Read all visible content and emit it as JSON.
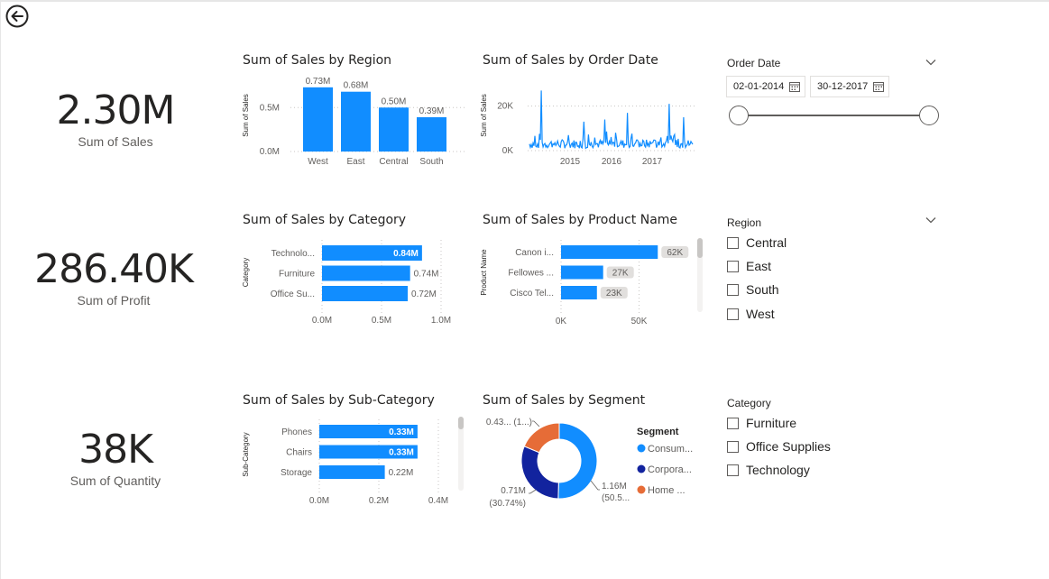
{
  "kpis": [
    {
      "value": "2.30M",
      "label": "Sum of Sales"
    },
    {
      "value": "286.40K",
      "label": "Sum of Profit"
    },
    {
      "value": "38K",
      "label": "Sum of Quantity"
    }
  ],
  "visual_titles": {
    "region": "Sum of Sales by Region",
    "order_date": "Sum of Sales by Order Date",
    "category": "Sum of Sales by Category",
    "product": "Sum of Sales by Product Name",
    "subcategory": "Sum of Sales by Sub-Category",
    "segment": "Sum of Sales by Segment"
  },
  "slicers": {
    "order_date": {
      "title": "Order Date",
      "start": "02-01-2014",
      "end": "30-12-2017"
    },
    "region": {
      "title": "Region",
      "items": [
        "Central",
        "East",
        "South",
        "West"
      ]
    },
    "category": {
      "title": "Category",
      "items": [
        "Furniture",
        "Office Supplies",
        "Technology"
      ]
    }
  },
  "colors": {
    "bar": "#118dff",
    "dark_blue": "#12239e",
    "orange": "#e66c37",
    "accent": "#118dff"
  },
  "icons": [
    "back-arrow-icon",
    "chevron-down-icon",
    "calendar-icon"
  ],
  "chart_data": [
    {
      "type": "bar",
      "title": "Sum of Sales by Region",
      "ylabel": "Sum of Sales",
      "categories": [
        "West",
        "East",
        "Central",
        "South"
      ],
      "values": [
        0.73,
        0.68,
        0.5,
        0.39
      ],
      "data_labels": [
        "0.73M",
        "0.68M",
        "0.50M",
        "0.39M"
      ],
      "y_ticks": [
        "0.0M",
        "0.5M"
      ],
      "ylim": [
        0,
        0.8
      ]
    },
    {
      "type": "line",
      "title": "Sum of Sales by Order Date",
      "ylabel": "Sum of Sales",
      "x_ticks": [
        "2015",
        "2016",
        "2017"
      ],
      "y_ticks": [
        "0K",
        "20K"
      ],
      "ylim": [
        0,
        30
      ]
    },
    {
      "type": "bar",
      "orientation": "horizontal",
      "title": "Sum of Sales by Category",
      "ylabel": "Category",
      "categories": [
        "Technolo...",
        "Furniture",
        "Office Su..."
      ],
      "values": [
        0.84,
        0.74,
        0.72
      ],
      "data_labels": [
        "0.84M",
        "0.74M",
        "0.72M"
      ],
      "x_ticks": [
        "0.0M",
        "0.5M",
        "1.0M"
      ],
      "xlim": [
        0,
        1.0
      ]
    },
    {
      "type": "bar",
      "orientation": "horizontal",
      "title": "Sum of Sales by Product Name",
      "ylabel": "Product Name",
      "categories": [
        "Canon i...",
        "Fellowes ...",
        "Cisco Tel..."
      ],
      "values": [
        62,
        27,
        23
      ],
      "data_labels": [
        "62K",
        "27K",
        "23K"
      ],
      "x_ticks": [
        "0K",
        "50K"
      ],
      "xlim": [
        0,
        70
      ]
    },
    {
      "type": "bar",
      "orientation": "horizontal",
      "title": "Sum of Sales by Sub-Category",
      "ylabel": "Sub-Category",
      "categories": [
        "Phones",
        "Chairs",
        "Storage"
      ],
      "values": [
        0.33,
        0.33,
        0.22
      ],
      "data_labels": [
        "0.33M",
        "0.33M",
        "0.22M"
      ],
      "x_ticks": [
        "0.0M",
        "0.2M",
        "0.4M"
      ],
      "xlim": [
        0,
        0.4
      ]
    },
    {
      "type": "pie",
      "title": "Sum of Sales by Segment",
      "legend_title": "Segment",
      "categories": [
        "Consum...",
        "Corpora...",
        "Home ..."
      ],
      "values": [
        1.16,
        0.71,
        0.43
      ],
      "slice_labels": [
        [
          "1.16M",
          "(50.5..."
        ],
        [
          "0.71M",
          "(30.74%)"
        ],
        [
          "0.43... (1...)"
        ]
      ],
      "colors": [
        "#118dff",
        "#12239e",
        "#e66c37"
      ]
    }
  ]
}
